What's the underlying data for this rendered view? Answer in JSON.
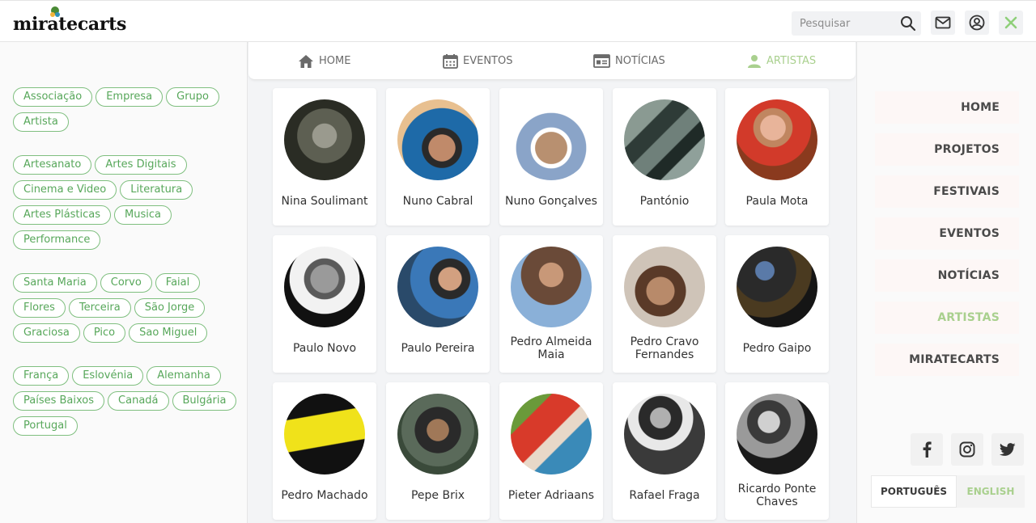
{
  "header": {
    "logo": "miratecarts",
    "search_placeholder": "Pesquisar"
  },
  "filters": {
    "types": [
      "Associação",
      "Empresa",
      "Grupo",
      "Artista"
    ],
    "disciplines": [
      "Artesanato",
      "Artes Digitais",
      "Cinema e Video",
      "Literatura",
      "Artes Plásticas",
      "Musica",
      "Performance"
    ],
    "islands": [
      "Santa Maria",
      "Corvo",
      "Faial",
      "Flores",
      "Terceira",
      "São Jorge",
      "Graciosa",
      "Pico",
      "Sao Miguel"
    ],
    "countries": [
      "França",
      "Eslovénia",
      "Alemanha",
      "Países Baixos",
      "Canadá",
      "Bulgária",
      "Portugal"
    ]
  },
  "topnav": {
    "home": "HOME",
    "eventos": "EVENTOS",
    "noticias": "NOTÍCIAS",
    "artistas": "ARTISTAS"
  },
  "artists": [
    "Nina Soulimant",
    "Nuno Cabral",
    "Nuno Gonçalves",
    "Pantónio",
    "Paula Mota",
    "Paulo Novo",
    "Paulo Pereira",
    "Pedro Almeida Maia",
    "Pedro Cravo Fernandes",
    "Pedro Gaipo",
    "Pedro Machado",
    "Pepe Brix",
    "Pieter Adriaans",
    "Rafael Fraga",
    "Ricardo Ponte Chaves"
  ],
  "sidenav": {
    "home": "HOME",
    "projetos": "PROJETOS",
    "festivais": "FESTIVAIS",
    "eventos": "EVENTOS",
    "noticias": "NOTÍCIAS",
    "artistas": "ARTISTAS",
    "miratecarts": "MIRATECARTS"
  },
  "language": {
    "pt": "PORTUGUÊS",
    "en": "ENGLISH"
  },
  "colors": {
    "accent_green": "#a9d08e",
    "tag_green": "#57a75a"
  }
}
